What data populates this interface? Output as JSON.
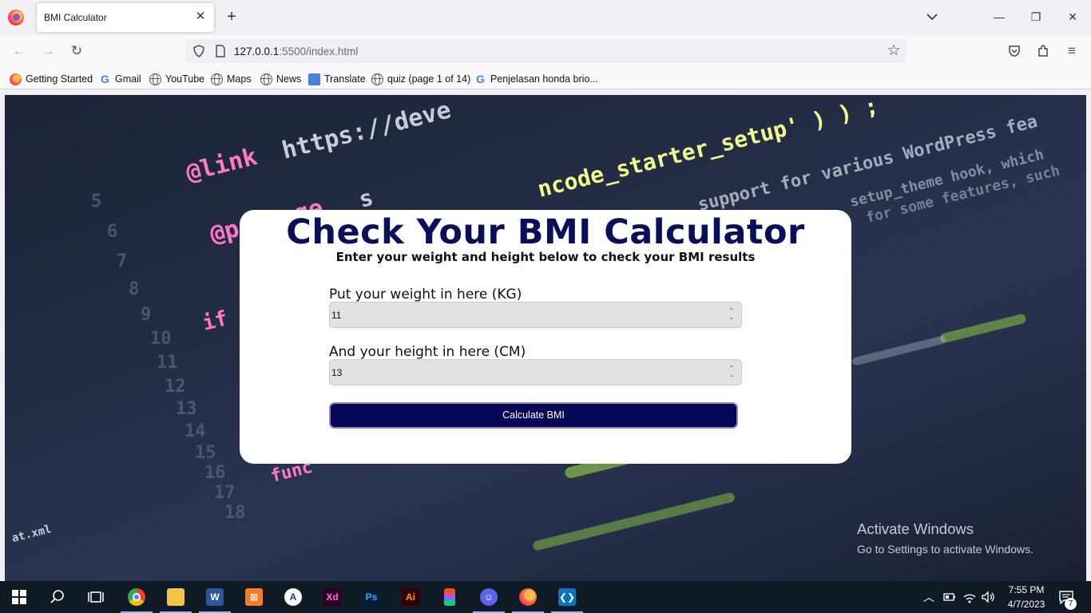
{
  "browser": {
    "tab_title": "BMI Calculator",
    "url_host": "127.0.0.1",
    "url_rest": ":5500/index.html",
    "bookmarks": [
      {
        "label": "Getting Started",
        "icon": "firefox-icon"
      },
      {
        "label": "Gmail",
        "icon": "google-icon"
      },
      {
        "label": "YouTube",
        "icon": "globe-icon"
      },
      {
        "label": "Maps",
        "icon": "globe-icon"
      },
      {
        "label": "News",
        "icon": "globe-icon"
      },
      {
        "label": "Translate",
        "icon": "translate-icon"
      },
      {
        "label": "quiz (page 1 of 14)",
        "icon": "globe-icon"
      },
      {
        "label": "Penjelasan honda brio...",
        "icon": "google-icon"
      }
    ]
  },
  "page": {
    "title": "Check Your BMI Calculator",
    "subtitle": "Enter your weight and height below to check your BMI results",
    "weight_label": "Put your weight in here (KG)",
    "weight_value": "11",
    "height_label": "And your height in here (CM)",
    "height_value": "13",
    "button_label": "Calculate BMI",
    "accent_color": "#060656"
  },
  "watermark": {
    "line1": "Activate Windows",
    "line2": "Go to Settings to activate Windows."
  },
  "taskbar": {
    "time": "7:55 PM",
    "date": "4/7/2023",
    "notification_count": "7",
    "apps": [
      "windows-start-icon",
      "search-icon",
      "task-view-icon",
      "chrome-icon",
      "file-explorer-icon",
      "word-icon",
      "xampp-icon",
      "app-icon",
      "adobe-xd-icon",
      "photoshop-icon",
      "illustrator-icon",
      "figma-icon",
      "discord-icon",
      "firefox-icon",
      "vscode-icon"
    ]
  }
}
